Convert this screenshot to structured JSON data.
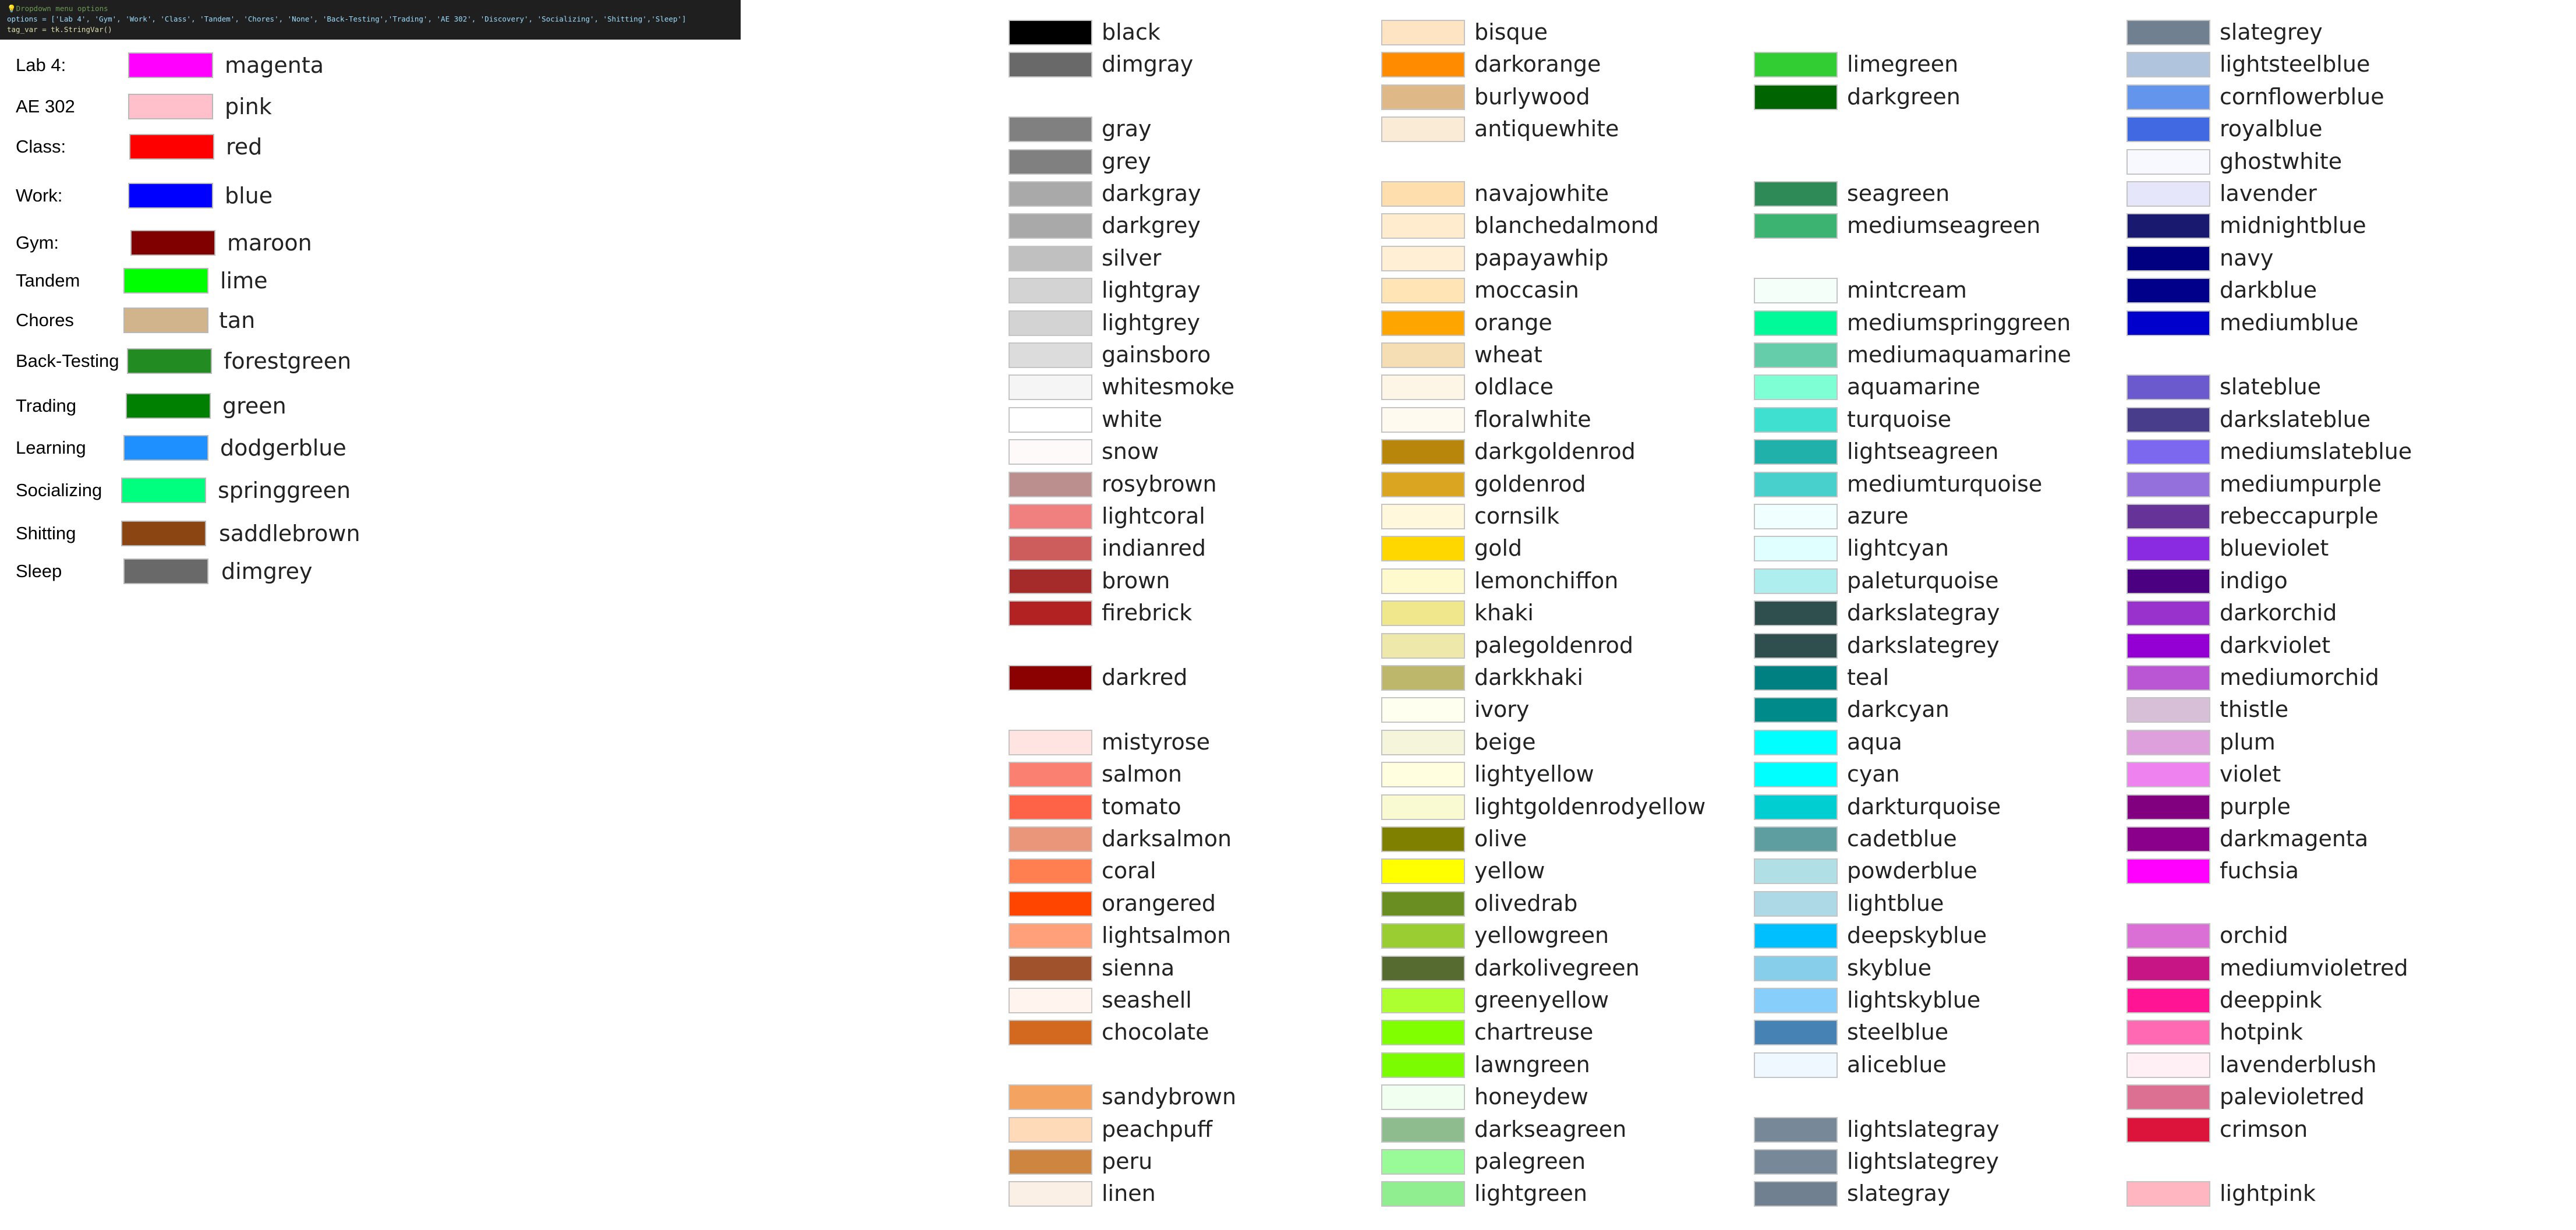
{
  "code_panel": {
    "comment": "Dropdown menu options",
    "line_options": "options = ['Lab 4', 'Gym', 'Work', 'Class', 'Tandem', 'Chores', 'None', 'Back-Testing','Trading', 'AE 302', 'Discovery', 'Socializing', 'Shitting','Sleep']",
    "line_tag_var": "tag_var = tk.StringVar()"
  },
  "tag_legend": [
    {
      "label": "Lab 4:",
      "color_name": "magenta",
      "color": "#ff00ff"
    },
    {
      "label": "AE 302",
      "color_name": "pink",
      "color": "#ffc0cb"
    },
    {
      "label": "Class:",
      "color_name": "red",
      "color": "#ff0000"
    },
    {
      "label": "Work:",
      "color_name": "blue",
      "color": "#0000ff"
    },
    {
      "label": "Gym:",
      "color_name": "maroon",
      "color": "#800000"
    },
    {
      "label": "Tandem",
      "color_name": "lime",
      "color": "#00ff00"
    },
    {
      "label": "Chores",
      "color_name": "tan",
      "color": "#d2b48c"
    },
    {
      "label": "Back-Testing",
      "color_name": "forestgreen",
      "color": "#228b22"
    },
    {
      "label": "Trading",
      "color_name": "green",
      "color": "#008000"
    },
    {
      "label": "Learning",
      "color_name": "dodgerblue",
      "color": "#1e90ff"
    },
    {
      "label": "Socializing",
      "color_name": "springgreen",
      "color": "#00ff7f"
    },
    {
      "label": "Shitting",
      "color_name": "saddlebrown",
      "color": "#8b4513"
    },
    {
      "label": "Sleep",
      "color_name": "dimgrey",
      "color": "#696969"
    }
  ],
  "named_colors": [
    [
      {
        "name": "black",
        "color": "#000000",
        "row": 0
      },
      {
        "name": "dimgray",
        "color": "#696969",
        "row": 1
      },
      {
        "name": "gray",
        "color": "#808080",
        "row": 3
      },
      {
        "name": "grey",
        "color": "#808080",
        "row": 4
      },
      {
        "name": "darkgray",
        "color": "#a9a9a9",
        "row": 5
      },
      {
        "name": "darkgrey",
        "color": "#a9a9a9",
        "row": 6
      },
      {
        "name": "silver",
        "color": "#c0c0c0",
        "row": 7
      },
      {
        "name": "lightgray",
        "color": "#d3d3d3",
        "row": 8
      },
      {
        "name": "lightgrey",
        "color": "#d3d3d3",
        "row": 9
      },
      {
        "name": "gainsboro",
        "color": "#dcdcdc",
        "row": 10
      },
      {
        "name": "whitesmoke",
        "color": "#f5f5f5",
        "row": 11
      },
      {
        "name": "white",
        "color": "#ffffff",
        "row": 12
      },
      {
        "name": "snow",
        "color": "#fffafa",
        "row": 13
      },
      {
        "name": "rosybrown",
        "color": "#bc8f8f",
        "row": 14
      },
      {
        "name": "lightcoral",
        "color": "#f08080",
        "row": 15
      },
      {
        "name": "indianred",
        "color": "#cd5c5c",
        "row": 16
      },
      {
        "name": "brown",
        "color": "#a52a2a",
        "row": 17
      },
      {
        "name": "firebrick",
        "color": "#b22222",
        "row": 18
      },
      {
        "name": "darkred",
        "color": "#8b0000",
        "row": 20
      },
      {
        "name": "mistyrose",
        "color": "#ffe4e1",
        "row": 22
      },
      {
        "name": "salmon",
        "color": "#fa8072",
        "row": 23
      },
      {
        "name": "tomato",
        "color": "#ff6347",
        "row": 24
      },
      {
        "name": "darksalmon",
        "color": "#e9967a",
        "row": 25
      },
      {
        "name": "coral",
        "color": "#ff7f50",
        "row": 26
      },
      {
        "name": "orangered",
        "color": "#ff4500",
        "row": 27
      },
      {
        "name": "lightsalmon",
        "color": "#ffa07a",
        "row": 28
      },
      {
        "name": "sienna",
        "color": "#a0522d",
        "row": 29
      },
      {
        "name": "seashell",
        "color": "#fff5ee",
        "row": 30
      },
      {
        "name": "chocolate",
        "color": "#d2691e",
        "row": 31
      },
      {
        "name": "sandybrown",
        "color": "#f4a460",
        "row": 33
      },
      {
        "name": "peachpuff",
        "color": "#ffdab9",
        "row": 34
      },
      {
        "name": "peru",
        "color": "#cd853f",
        "row": 35
      },
      {
        "name": "linen",
        "color": "#faf0e6",
        "row": 36
      }
    ],
    [
      {
        "name": "bisque",
        "color": "#ffe4c4",
        "row": 0
      },
      {
        "name": "darkorange",
        "color": "#ff8c00",
        "row": 1
      },
      {
        "name": "burlywood",
        "color": "#deb887",
        "row": 2
      },
      {
        "name": "antiquewhite",
        "color": "#faebd7",
        "row": 3
      },
      {
        "name": "navajowhite",
        "color": "#ffdead",
        "row": 5
      },
      {
        "name": "blanchedalmond",
        "color": "#ffebcd",
        "row": 6
      },
      {
        "name": "papayawhip",
        "color": "#ffefd5",
        "row": 7
      },
      {
        "name": "moccasin",
        "color": "#ffe4b5",
        "row": 8
      },
      {
        "name": "orange",
        "color": "#ffa500",
        "row": 9
      },
      {
        "name": "wheat",
        "color": "#f5deb3",
        "row": 10
      },
      {
        "name": "oldlace",
        "color": "#fdf5e6",
        "row": 11
      },
      {
        "name": "floralwhite",
        "color": "#fffaf0",
        "row": 12
      },
      {
        "name": "darkgoldenrod",
        "color": "#b8860b",
        "row": 13
      },
      {
        "name": "goldenrod",
        "color": "#daa520",
        "row": 14
      },
      {
        "name": "cornsilk",
        "color": "#fff8dc",
        "row": 15
      },
      {
        "name": "gold",
        "color": "#ffd700",
        "row": 16
      },
      {
        "name": "lemonchiffon",
        "color": "#fffacd",
        "row": 17
      },
      {
        "name": "khaki",
        "color": "#f0e68c",
        "row": 18
      },
      {
        "name": "palegoldenrod",
        "color": "#eee8aa",
        "row": 19
      },
      {
        "name": "darkkhaki",
        "color": "#bdb76b",
        "row": 20
      },
      {
        "name": "ivory",
        "color": "#fffff0",
        "row": 21
      },
      {
        "name": "beige",
        "color": "#f5f5dc",
        "row": 22
      },
      {
        "name": "lightyellow",
        "color": "#ffffe0",
        "row": 23
      },
      {
        "name": "lightgoldenrodyellow",
        "color": "#fafad2",
        "row": 24
      },
      {
        "name": "olive",
        "color": "#808000",
        "row": 25
      },
      {
        "name": "yellow",
        "color": "#ffff00",
        "row": 26
      },
      {
        "name": "olivedrab",
        "color": "#6b8e23",
        "row": 27
      },
      {
        "name": "yellowgreen",
        "color": "#9acd32",
        "row": 28
      },
      {
        "name": "darkolivegreen",
        "color": "#556b2f",
        "row": 29
      },
      {
        "name": "greenyellow",
        "color": "#adff2f",
        "row": 30
      },
      {
        "name": "chartreuse",
        "color": "#7fff00",
        "row": 31
      },
      {
        "name": "lawngreen",
        "color": "#7cfc00",
        "row": 32
      },
      {
        "name": "honeydew",
        "color": "#f0fff0",
        "row": 33
      },
      {
        "name": "darkseagreen",
        "color": "#8fbc8f",
        "row": 34
      },
      {
        "name": "palegreen",
        "color": "#98fb98",
        "row": 35
      },
      {
        "name": "lightgreen",
        "color": "#90ee90",
        "row": 36
      }
    ],
    [
      {
        "name": "limegreen",
        "color": "#32cd32",
        "row": 1
      },
      {
        "name": "darkgreen",
        "color": "#006400",
        "row": 2
      },
      {
        "name": "seagreen",
        "color": "#2e8b57",
        "row": 5
      },
      {
        "name": "mediumseagreen",
        "color": "#3cb371",
        "row": 6
      },
      {
        "name": "mintcream",
        "color": "#f5fffa",
        "row": 8
      },
      {
        "name": "mediumspringgreen",
        "color": "#00fa9a",
        "row": 9
      },
      {
        "name": "mediumaquamarine",
        "color": "#66cdaa",
        "row": 10
      },
      {
        "name": "aquamarine",
        "color": "#7fffd4",
        "row": 11
      },
      {
        "name": "turquoise",
        "color": "#40e0d0",
        "row": 12
      },
      {
        "name": "lightseagreen",
        "color": "#20b2aa",
        "row": 13
      },
      {
        "name": "mediumturquoise",
        "color": "#48d1cc",
        "row": 14
      },
      {
        "name": "azure",
        "color": "#f0ffff",
        "row": 15
      },
      {
        "name": "lightcyan",
        "color": "#e0ffff",
        "row": 16
      },
      {
        "name": "paleturquoise",
        "color": "#afeeee",
        "row": 17
      },
      {
        "name": "darkslategray",
        "color": "#2f4f4f",
        "row": 18
      },
      {
        "name": "darkslategrey",
        "color": "#2f4f4f",
        "row": 19
      },
      {
        "name": "teal",
        "color": "#008080",
        "row": 20
      },
      {
        "name": "darkcyan",
        "color": "#008b8b",
        "row": 21
      },
      {
        "name": "aqua",
        "color": "#00ffff",
        "row": 22
      },
      {
        "name": "cyan",
        "color": "#00ffff",
        "row": 23
      },
      {
        "name": "darkturquoise",
        "color": "#00ced1",
        "row": 24
      },
      {
        "name": "cadetblue",
        "color": "#5f9ea0",
        "row": 25
      },
      {
        "name": "powderblue",
        "color": "#b0e0e6",
        "row": 26
      },
      {
        "name": "lightblue",
        "color": "#add8e6",
        "row": 27
      },
      {
        "name": "deepskyblue",
        "color": "#00bfff",
        "row": 28
      },
      {
        "name": "skyblue",
        "color": "#87ceeb",
        "row": 29
      },
      {
        "name": "lightskyblue",
        "color": "#87cefa",
        "row": 30
      },
      {
        "name": "steelblue",
        "color": "#4682b4",
        "row": 31
      },
      {
        "name": "aliceblue",
        "color": "#f0f8ff",
        "row": 32
      },
      {
        "name": "lightslategray",
        "color": "#778899",
        "row": 34
      },
      {
        "name": "lightslategrey",
        "color": "#778899",
        "row": 35
      },
      {
        "name": "slategray",
        "color": "#708090",
        "row": 36
      }
    ],
    [
      {
        "name": "slategrey",
        "color": "#708090",
        "row": 0
      },
      {
        "name": "lightsteelblue",
        "color": "#b0c4de",
        "row": 1
      },
      {
        "name": "cornflowerblue",
        "color": "#6495ed",
        "row": 2
      },
      {
        "name": "royalblue",
        "color": "#4169e1",
        "row": 3
      },
      {
        "name": "ghostwhite",
        "color": "#f8f8ff",
        "row": 4
      },
      {
        "name": "lavender",
        "color": "#e6e6fa",
        "row": 5
      },
      {
        "name": "midnightblue",
        "color": "#191970",
        "row": 6
      },
      {
        "name": "navy",
        "color": "#000080",
        "row": 7
      },
      {
        "name": "darkblue",
        "color": "#00008b",
        "row": 8
      },
      {
        "name": "mediumblue",
        "color": "#0000cd",
        "row": 9
      },
      {
        "name": "slateblue",
        "color": "#6a5acd",
        "row": 11
      },
      {
        "name": "darkslateblue",
        "color": "#483d8b",
        "row": 12
      },
      {
        "name": "mediumslateblue",
        "color": "#7b68ee",
        "row": 13
      },
      {
        "name": "mediumpurple",
        "color": "#9370db",
        "row": 14
      },
      {
        "name": "rebeccapurple",
        "color": "#663399",
        "row": 15
      },
      {
        "name": "blueviolet",
        "color": "#8a2be2",
        "row": 16
      },
      {
        "name": "indigo",
        "color": "#4b0082",
        "row": 17
      },
      {
        "name": "darkorchid",
        "color": "#9932cc",
        "row": 18
      },
      {
        "name": "darkviolet",
        "color": "#9400d3",
        "row": 19
      },
      {
        "name": "mediumorchid",
        "color": "#ba55d3",
        "row": 20
      },
      {
        "name": "thistle",
        "color": "#d8bfd8",
        "row": 21
      },
      {
        "name": "plum",
        "color": "#dda0dd",
        "row": 22
      },
      {
        "name": "violet",
        "color": "#ee82ee",
        "row": 23
      },
      {
        "name": "purple",
        "color": "#800080",
        "row": 24
      },
      {
        "name": "darkmagenta",
        "color": "#8b008b",
        "row": 25
      },
      {
        "name": "fuchsia",
        "color": "#ff00ff",
        "row": 26
      },
      {
        "name": "orchid",
        "color": "#da70d6",
        "row": 28
      },
      {
        "name": "mediumvioletred",
        "color": "#c71585",
        "row": 29
      },
      {
        "name": "deeppink",
        "color": "#ff1493",
        "row": 30
      },
      {
        "name": "hotpink",
        "color": "#ff69b4",
        "row": 31
      },
      {
        "name": "lavenderblush",
        "color": "#fff0f5",
        "row": 32
      },
      {
        "name": "palevioletred",
        "color": "#db7093",
        "row": 33
      },
      {
        "name": "crimson",
        "color": "#dc143c",
        "row": 34
      },
      {
        "name": "lightpink",
        "color": "#ffb6c1",
        "row": 36
      }
    ]
  ]
}
